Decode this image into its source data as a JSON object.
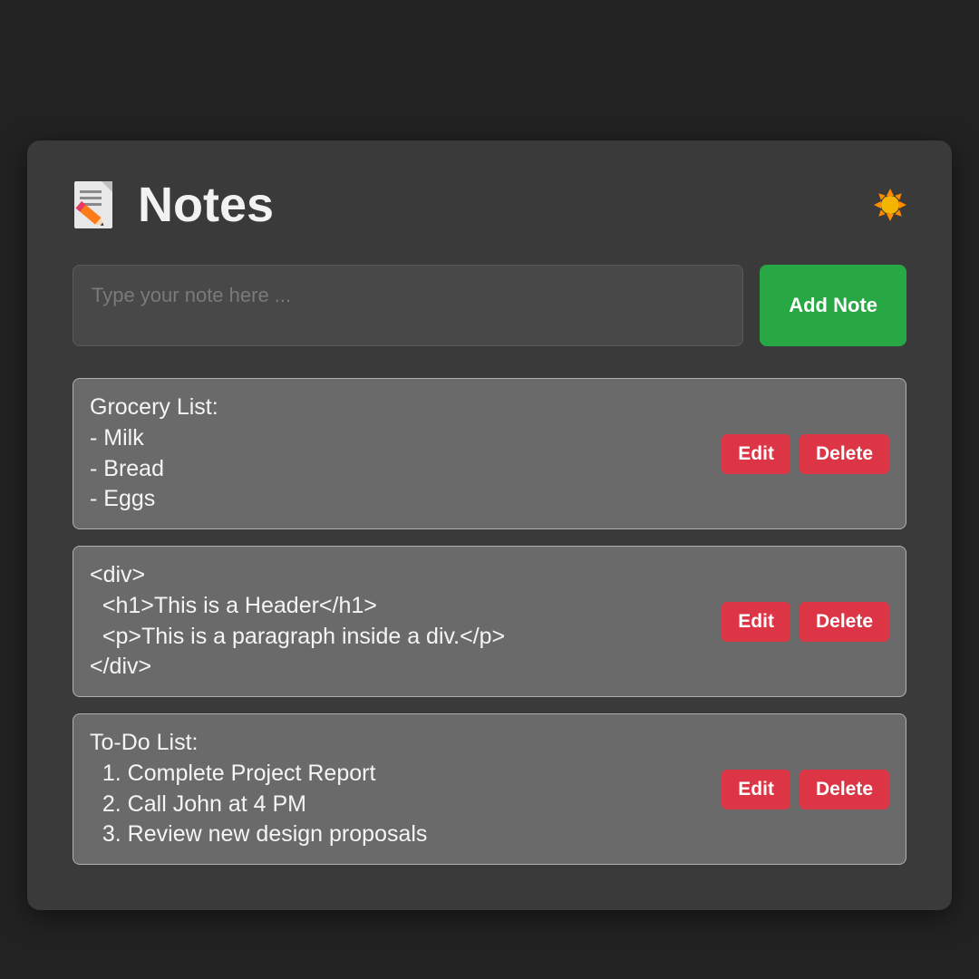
{
  "header": {
    "title": "Notes"
  },
  "input": {
    "placeholder": "Type your note here ...",
    "add_label": "Add Note"
  },
  "buttons": {
    "edit": "Edit",
    "delete": "Delete"
  },
  "notes": [
    {
      "text": "Grocery List:\n- Milk\n- Bread\n- Eggs"
    },
    {
      "text": "<div>\n  <h1>This is a Header</h1>\n  <p>This is a paragraph inside a div.</p>\n</div>"
    },
    {
      "text": "To-Do List:\n  1. Complete Project Report\n  2. Call John at 4 PM\n  3. Review new design proposals"
    }
  ]
}
